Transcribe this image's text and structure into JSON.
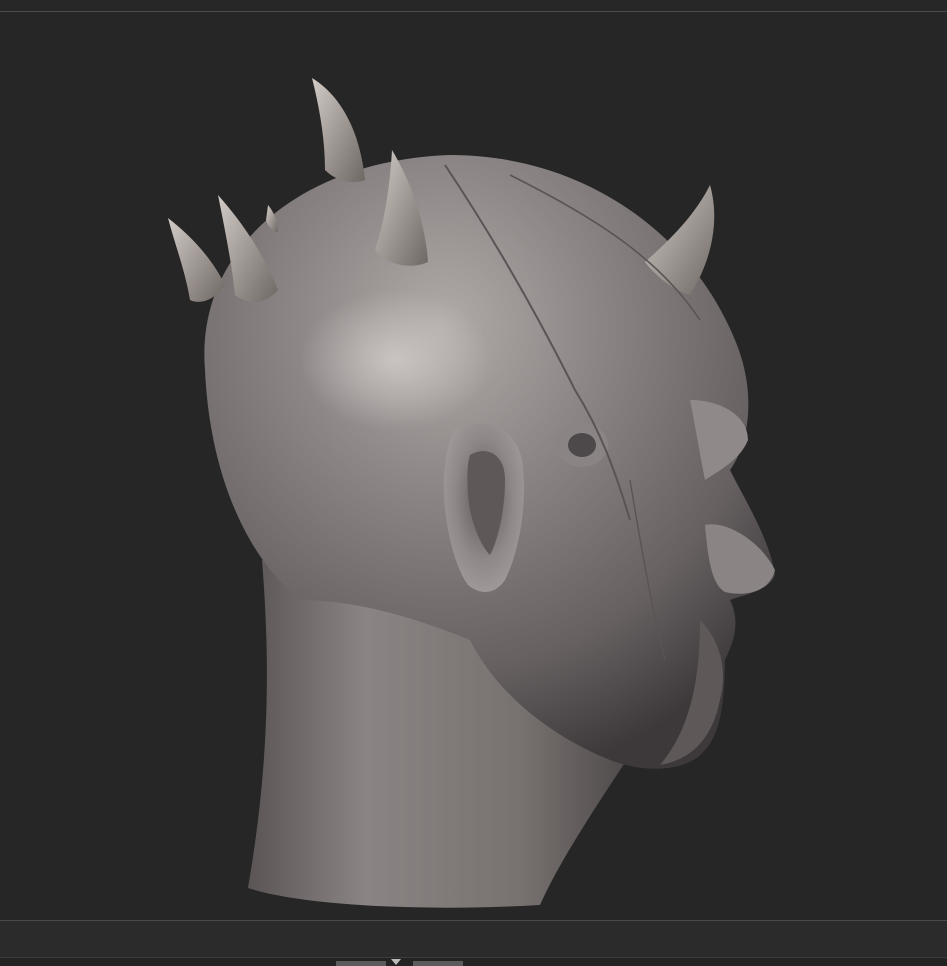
{
  "viewport": {
    "background": "#262626",
    "border_color": "#4a4a4a",
    "model_name": "sculpted-head-with-horns"
  },
  "colors": {
    "clay_light": "#a8a2a0",
    "clay_mid": "#7c7676",
    "clay_dark": "#4c4748",
    "horn_light": "#c9c2bd",
    "horn_dark": "#6e6763"
  },
  "scrollbar": {
    "arrow_icon": "triangle-down-icon"
  }
}
